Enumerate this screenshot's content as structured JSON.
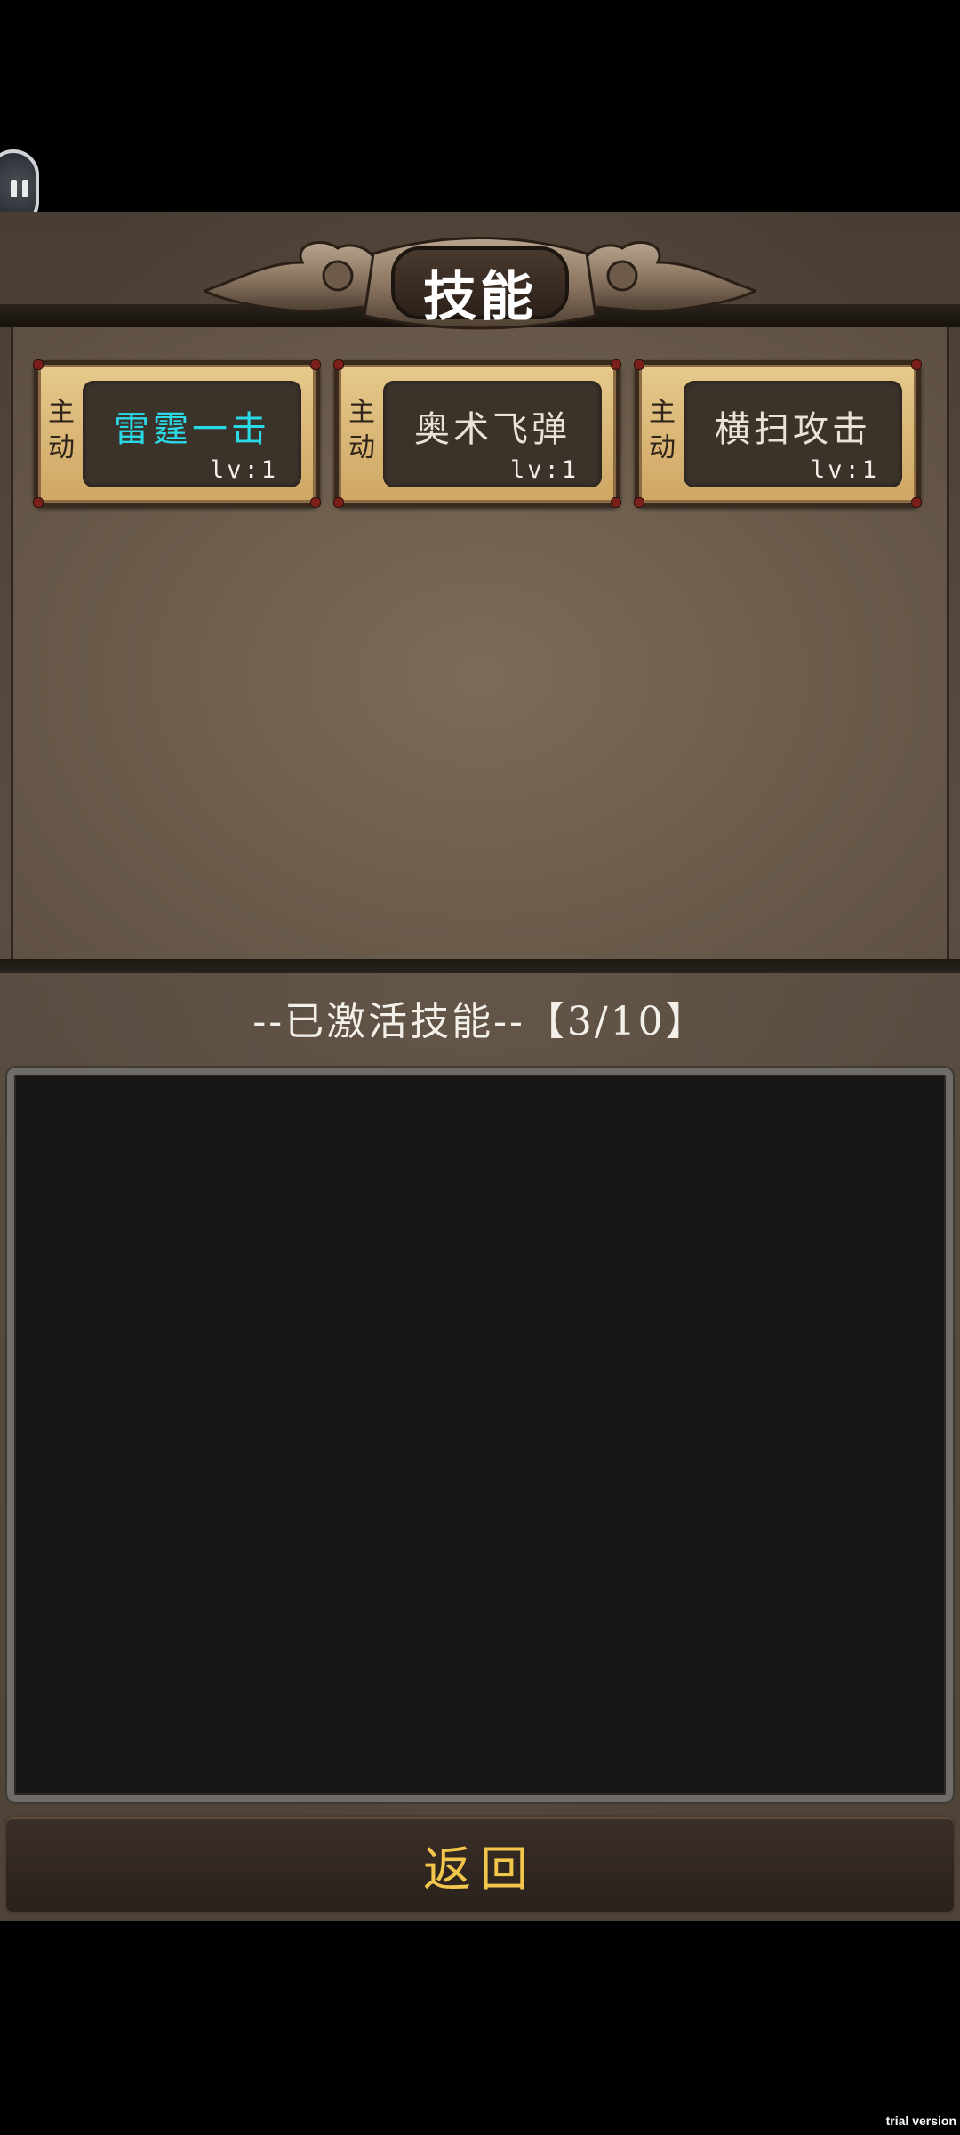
{
  "title": "技能",
  "skills": [
    {
      "type_char1": "主",
      "type_char2": "动",
      "name": "雷霆一击",
      "level": "lv:1",
      "highlighted": true
    },
    {
      "type_char1": "主",
      "type_char2": "动",
      "name": "奥术飞弹",
      "level": "lv:1",
      "highlighted": false
    },
    {
      "type_char1": "主",
      "type_char2": "动",
      "name": "横扫攻击",
      "level": "lv:1",
      "highlighted": false
    }
  ],
  "activated_label": "--已激活技能--【3/10】",
  "back_button": "返回",
  "watermark": "trial version",
  "colors": {
    "highlight_skill": "#29d9e6",
    "back_label": "#f2c64a"
  },
  "icons": {
    "pause": "pause-icon"
  }
}
